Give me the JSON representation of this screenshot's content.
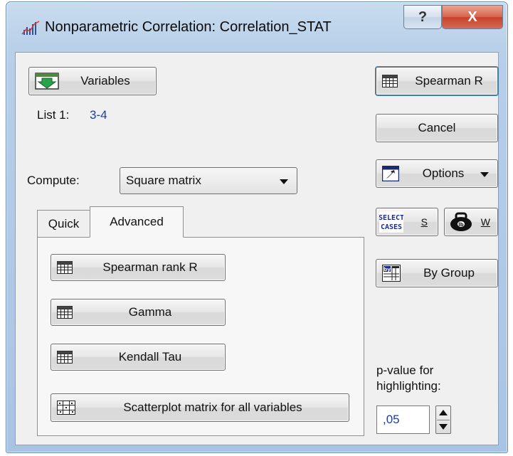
{
  "window": {
    "title": "Nonparametric Correlation: Correlation_STAT",
    "help_symbol": "?",
    "close_symbol": "X"
  },
  "variables": {
    "button_label": "Variables",
    "list_label": "List 1:",
    "list_value": "3-4"
  },
  "compute": {
    "label": "Compute:",
    "selected": "Square matrix"
  },
  "tabs": [
    {
      "label": "Quick",
      "active": false
    },
    {
      "label": "Advanced",
      "active": true
    }
  ],
  "advanced": {
    "spearman_rank": "Spearman rank R",
    "gamma": "Gamma",
    "kendall": "Kendall Tau",
    "scatterplot": "Scatterplot matrix for all variables"
  },
  "right_panel": {
    "spearman": "Spearman R",
    "cancel": "Cancel",
    "options": "Options",
    "select_cases_icon_text": "SELECT CASES",
    "select_cases_key": "S",
    "weight_key": "W",
    "by_group": "By Group",
    "pvalue_label_line1": "p-value for",
    "pvalue_label_line2": "highlighting:",
    "pvalue_value": ",05"
  },
  "colors": {
    "list_value": "#1c3ca8",
    "window_frame": "#b7cfe8",
    "close_button": "#c7412a"
  },
  "icons": [
    "chart-app-icon",
    "variables-icon",
    "grid-icon",
    "options-icon",
    "select-cases-icon",
    "weight-icon",
    "by-group-icon",
    "scatterplot-grid-icon"
  ]
}
